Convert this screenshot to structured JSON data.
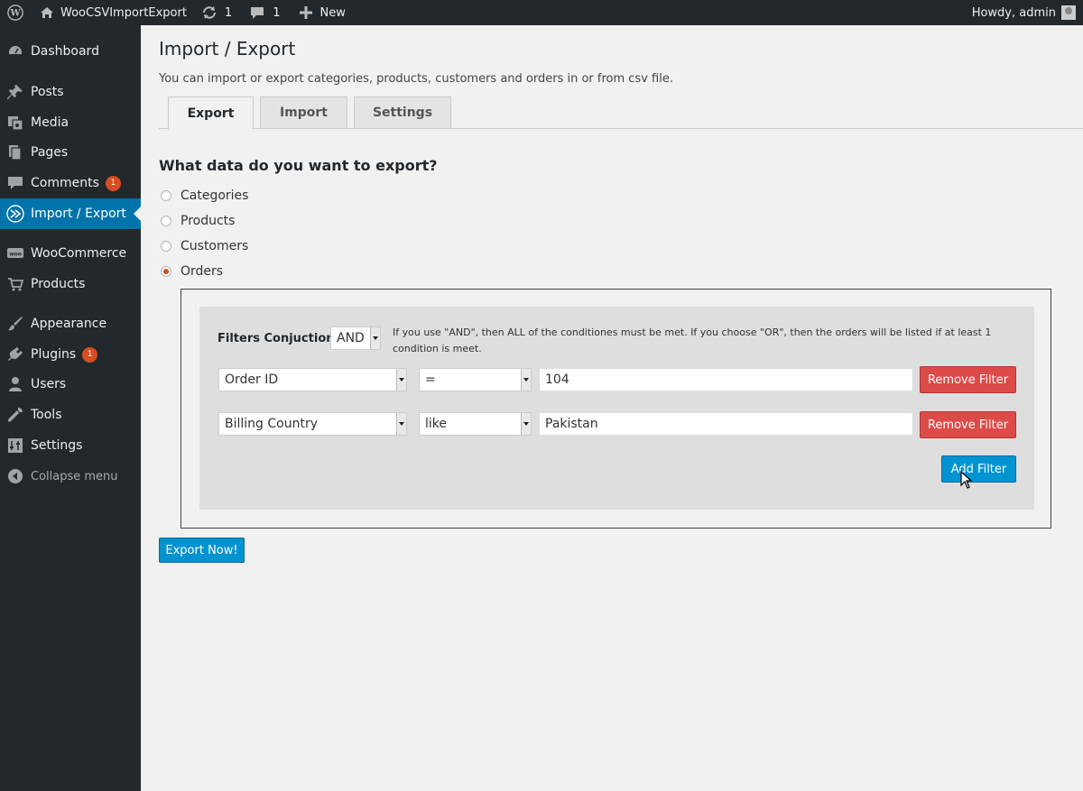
{
  "adminbar": {
    "site_name": "WooCSVImportExport",
    "updates_count": "1",
    "comments_count": "1",
    "new_label": "New",
    "howdy": "Howdy, admin"
  },
  "sidebar": {
    "items": [
      {
        "label": "Dashboard",
        "icon": "dashboard-icon"
      },
      {
        "label": "Posts",
        "icon": "pin-icon"
      },
      {
        "label": "Media",
        "icon": "media-icon"
      },
      {
        "label": "Pages",
        "icon": "pages-icon"
      },
      {
        "label": "Comments",
        "icon": "comment-icon",
        "badge": "1"
      },
      {
        "label": "Import / Export",
        "icon": "import-export-icon",
        "active": true
      },
      {
        "label": "WooCommerce",
        "icon": "woocommerce-icon"
      },
      {
        "label": "Products",
        "icon": "cart-icon"
      },
      {
        "label": "Appearance",
        "icon": "brush-icon"
      },
      {
        "label": "Plugins",
        "icon": "plugin-icon",
        "badge": "1"
      },
      {
        "label": "Users",
        "icon": "user-icon"
      },
      {
        "label": "Tools",
        "icon": "wrench-icon"
      },
      {
        "label": "Settings",
        "icon": "settings-icon"
      },
      {
        "label": "Collapse menu",
        "icon": "collapse-icon"
      }
    ]
  },
  "page": {
    "title": "Import / Export",
    "description": "You can import or export categories, products, customers and orders in or from csv file.",
    "tabs": [
      "Export",
      "Import",
      "Settings"
    ],
    "active_tab": "Export",
    "section_title": "What data do you want to export?",
    "options": [
      "Categories",
      "Products",
      "Customers",
      "Orders"
    ],
    "selected_option": "Orders"
  },
  "filters": {
    "conjunction_label": "Filters Conjuction:",
    "conjunction_value": "AND",
    "help_text": "If you use \"AND\", then ALL of the conditiones must be met. If you choose \"OR\", then the orders will be listed if at least 1 condition is meet.",
    "rows": [
      {
        "field": "Order ID",
        "operator": "=",
        "value": "104",
        "remove_label": "Remove Filter"
      },
      {
        "field": "Billing Country",
        "operator": "like",
        "value": "Pakistan",
        "remove_label": "Remove Filter"
      }
    ],
    "add_label": "Add Filter"
  },
  "export_button": "Export Now!",
  "colors": {
    "admin_dark": "#23282d",
    "accent_blue": "#0073aa",
    "button_blue": "#0093d1",
    "button_red": "#dd4b49",
    "badge_orange": "#d54e21"
  }
}
